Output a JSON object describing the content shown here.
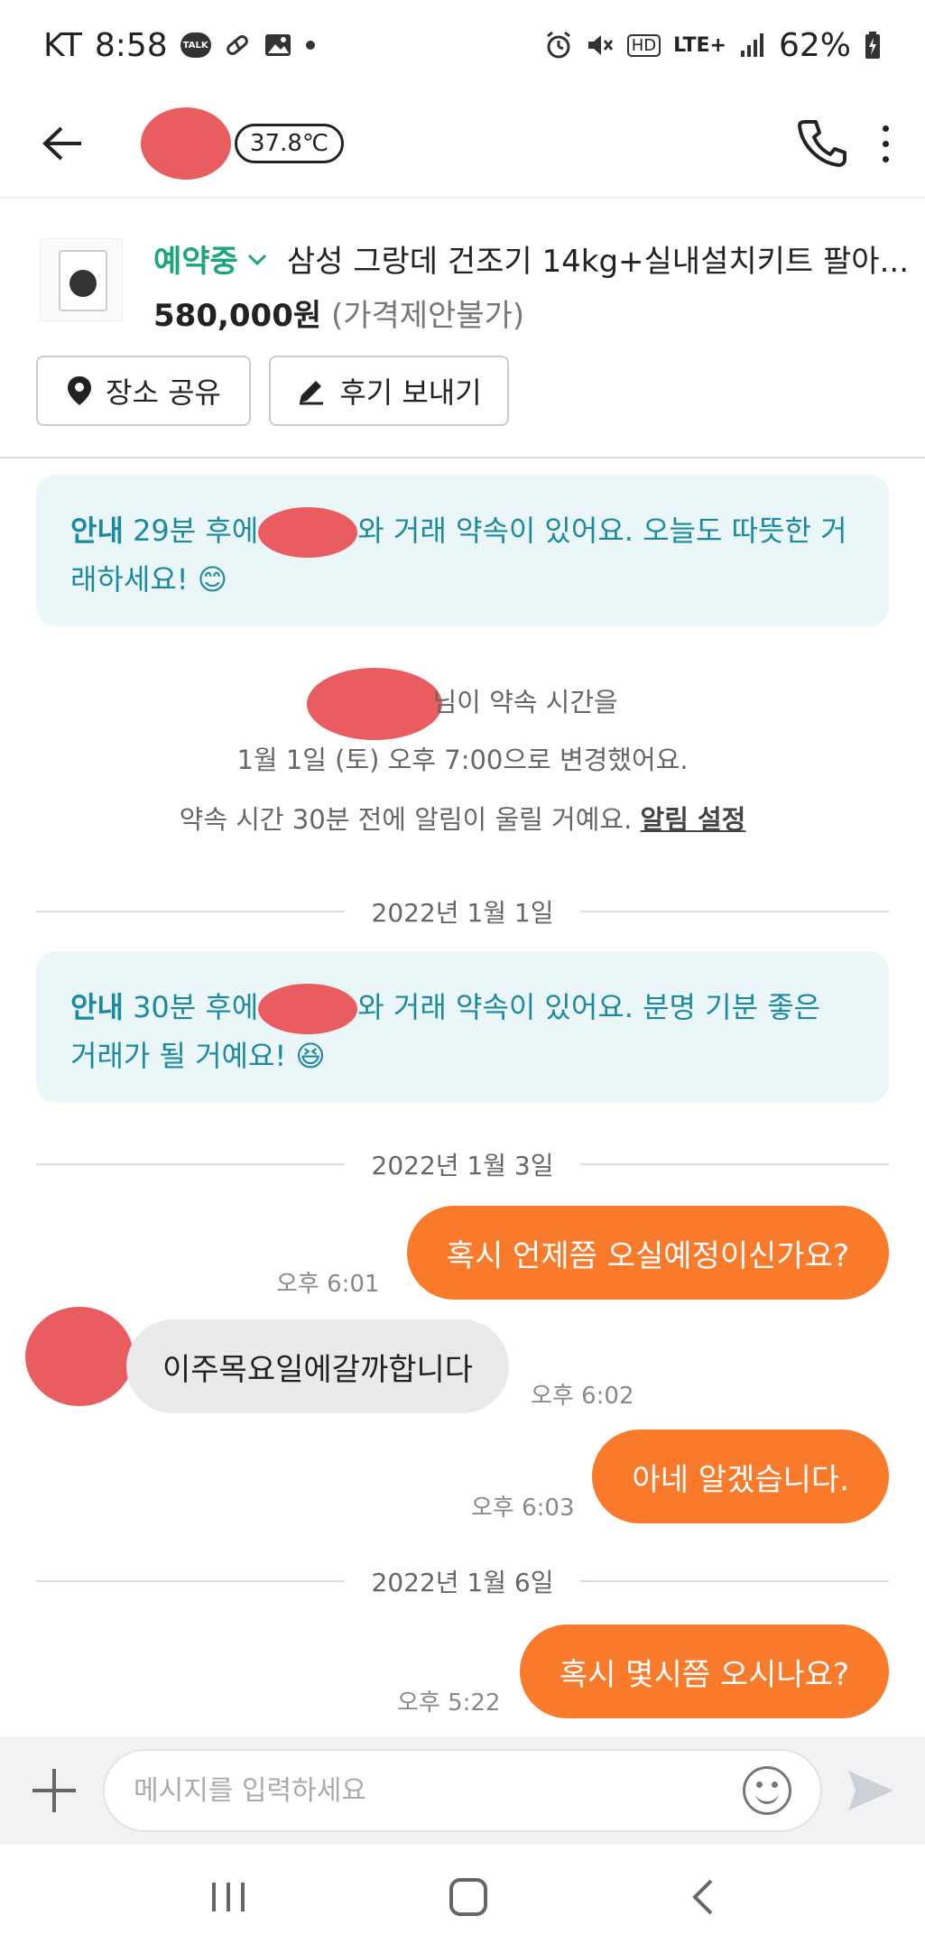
{
  "status_bar": {
    "carrier": "KT",
    "time": "8:58",
    "talk_badge": "TALK",
    "hd_badge": "HD",
    "network": "LTE+",
    "battery": "62%"
  },
  "header": {
    "temperature": "37.8℃"
  },
  "product": {
    "status": "예약중",
    "title": "삼성 그랑데 건조기 14kg+실내설치키트 팔아...",
    "price": "580,000원",
    "price_note": "(가격제안불가)",
    "share_location_label": "장소 공유",
    "send_review_label": "후기 보내기"
  },
  "chat": {
    "notice1": {
      "label": "안내",
      "text_before": " 29분 후에",
      "text_after": "와 거래 약속이 있어요. 오늘도 따뜻한 거래하세요! 😊"
    },
    "system1_line1": "님이 약속 시간을",
    "system1_line2": "1월 1일 (토) 오후 7:00으로 변경했어요.",
    "system2_text": "약속 시간 30분 전에 알림이 울릴 거예요. ",
    "system2_link": "알림 설정",
    "date1": "2022년 1월 1일",
    "notice2": {
      "label": "안내",
      "text_before": " 30분 후에",
      "text_after": "와 거래 약속이 있어요. 분명 기분 좋은 거래가 될 거예요! 😆"
    },
    "date2": "2022년 1월 3일",
    "msg1": {
      "text": "혹시 언제쯤 오실예정이신가요?",
      "time": "오후 6:01"
    },
    "msg2": {
      "text": "이주목요일에갈까합니다",
      "time": "오후 6:02"
    },
    "msg3": {
      "text": "아네 알겠습니다.",
      "time": "오후 6:03"
    },
    "date3": "2022년 1월 6일",
    "msg4": {
      "text": "혹시 몇시쯤 오시나요?",
      "time": "오후 5:22"
    }
  },
  "input": {
    "placeholder": "메시지를 입력하세요"
  },
  "colors": {
    "accent": "#fa7a2c",
    "reserved_green": "#1aa57b",
    "notice_bg": "#eaf6f7",
    "notice_text": "#1b8aa0",
    "redaction": "#e95c5f"
  }
}
